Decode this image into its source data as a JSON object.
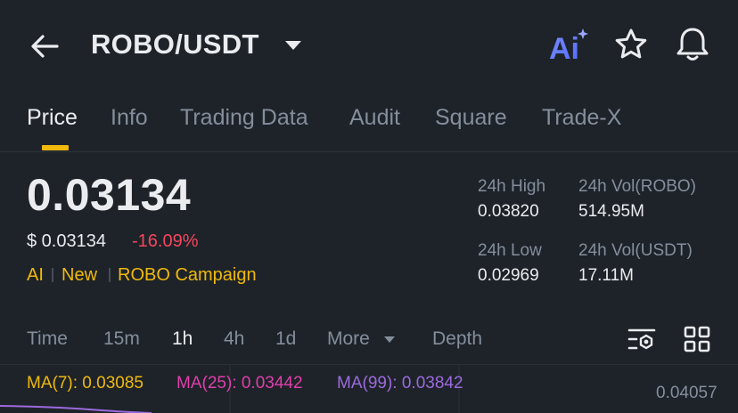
{
  "header": {
    "pair": "ROBO/USDT",
    "icons": [
      "back-arrow-icon",
      "caret-down-icon",
      "ai-icon",
      "star-icon",
      "bell-icon"
    ],
    "ai_label": "Ai"
  },
  "tabs": [
    {
      "label": "Price",
      "active": true
    },
    {
      "label": "Info"
    },
    {
      "label": "Trading Data"
    },
    {
      "label": "Audit"
    },
    {
      "label": "Square"
    },
    {
      "label": "Trade-X"
    }
  ],
  "price": {
    "last": "0.03134",
    "usd": "$ 0.03134",
    "change": "-16.09%"
  },
  "tags": [
    "AI",
    "New",
    "ROBO Campaign"
  ],
  "stats": {
    "high_label": "24h High",
    "high_value": "0.03820",
    "low_label": "24h Low",
    "low_value": "0.02969",
    "vol_base_label": "24h Vol(ROBO)",
    "vol_base_value": "514.95M",
    "vol_quote_label": "24h Vol(USDT)",
    "vol_quote_value": "17.11M"
  },
  "intervals": {
    "time": "Time",
    "m15": "15m",
    "h1": "1h",
    "h4": "4h",
    "d1": "1d",
    "more": "More",
    "depth": "Depth",
    "active": "1h"
  },
  "ma": {
    "ma7": "MA(7): 0.03085",
    "ma25": "MA(25): 0.03442",
    "ma99": "MA(99): 0.03842"
  },
  "axis": {
    "top_price": "0.04057"
  },
  "colors": {
    "background": "#1e2329",
    "accent": "#f0b90b",
    "down": "#f6465d",
    "ma7": "#f0b90b",
    "ma25": "#e03fab",
    "ma99": "#9c6ade"
  }
}
